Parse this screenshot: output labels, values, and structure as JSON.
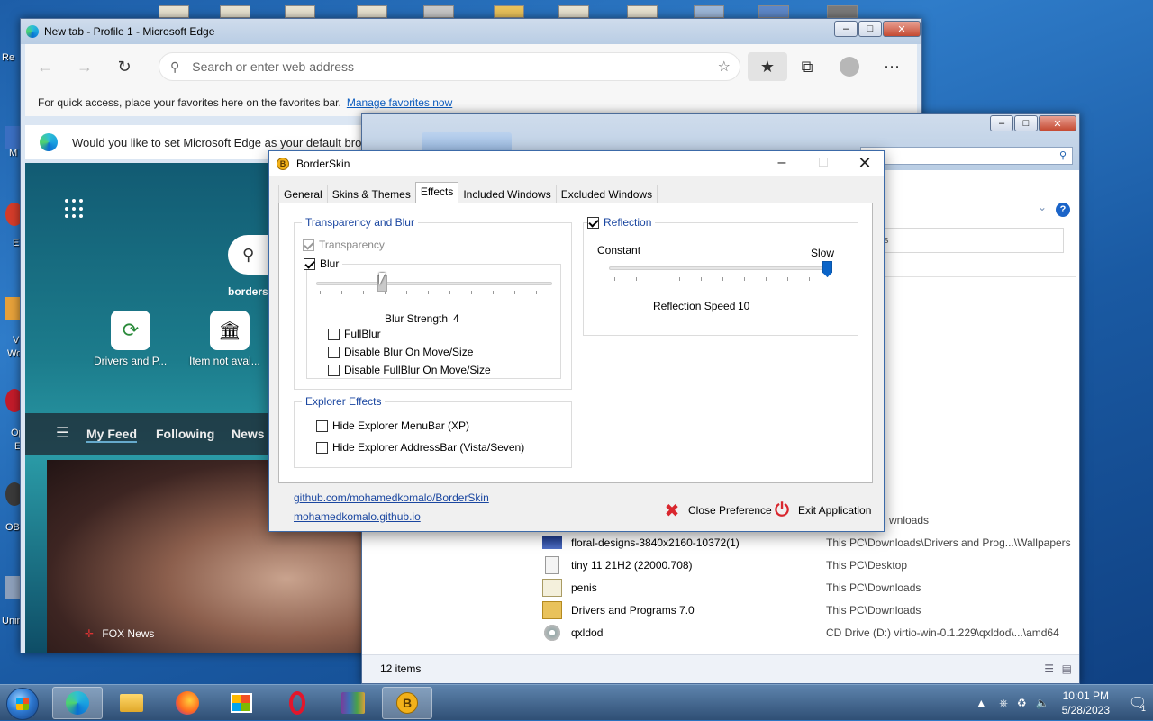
{
  "desktop": {
    "left_labels": [
      "Re",
      "M",
      "",
      "E",
      "",
      "V",
      "Wo",
      "",
      "Op",
      "E",
      "",
      "OBS",
      "",
      "Unin"
    ]
  },
  "edge": {
    "title": "New tab - Profile 1 - Microsoft Edge",
    "address_placeholder": "Search or enter web address",
    "favbar_text": "For quick access, place your favorites here on the favorites bar.",
    "favbar_link": "Manage favorites now",
    "default_prompt": "Would you like to set Microsoft Edge as your default bro",
    "search_partial": "bordersk",
    "tiles": [
      {
        "label": "Drivers and P..."
      },
      {
        "label": "Item not avai..."
      }
    ],
    "feed_tabs": [
      "My Feed",
      "Following",
      "News"
    ],
    "news_source": "FOX News"
  },
  "explorer": {
    "search_placeholder": "rch",
    "box_partial": "s",
    "files": [
      {
        "name": "",
        "location": "wnloads"
      },
      {
        "name": "floral-designs-3840x2160-10372(1)",
        "location": "This PC\\Downloads\\Drivers and Prog...\\Wallpapers"
      },
      {
        "name": "tiny 11 21H2 (22000.708)",
        "location": "This PC\\Desktop"
      },
      {
        "name": "penis",
        "location": "This PC\\Downloads"
      },
      {
        "name": "Drivers and Programs 7.0",
        "location": "This PC\\Downloads"
      },
      {
        "name": "qxldod",
        "location": "CD Drive (D:) virtio-win-0.1.229\\qxldod\\...\\amd64"
      }
    ],
    "status": "12 items"
  },
  "borderskin": {
    "title": "BorderSkin",
    "tabs": [
      "General",
      "Skins & Themes",
      "Effects",
      "Included Windows",
      "Excluded Windows"
    ],
    "active_tab": "Effects",
    "transparency_group": {
      "title": "Transparency and Blur",
      "transparency_label": "Transparency",
      "transparency_checked": true,
      "transparency_disabled": true,
      "blur_label": "Blur",
      "blur_checked": true,
      "blur_strength_label": "Blur Strength",
      "blur_strength_value": "4",
      "blur_strength_fraction": 0.27,
      "fullblur_label": "FullBlur",
      "disable_blur_move_label": "Disable Blur On Move/Size",
      "disable_fullblur_move_label": "Disable FullBlur On Move/Size"
    },
    "explorer_group": {
      "title": "Explorer Effects",
      "hide_menubar_label": "Hide Explorer MenuBar (XP)",
      "hide_addressbar_label": "Hide Explorer AddressBar (Vista/Seven)"
    },
    "reflection_group": {
      "title": "Reflection",
      "checked": true,
      "constant_label": "Constant",
      "slow_label": "Slow",
      "speed_label": "Reflection Speed",
      "speed_value": "10",
      "speed_fraction": 1.0
    },
    "links": [
      "github.com/mohamedkomalo/BorderSkin",
      "mohamedkomalo.github.io"
    ],
    "close_pref_label": "Close Preference",
    "exit_label": "Exit Application"
  },
  "taskbar": {
    "time": "10:01 PM",
    "date": "5/28/2023",
    "notification_count": "1"
  },
  "colors": {
    "accent": "#0a64c8",
    "group_title": "#1a46a0",
    "close_red": "#d9272e"
  }
}
